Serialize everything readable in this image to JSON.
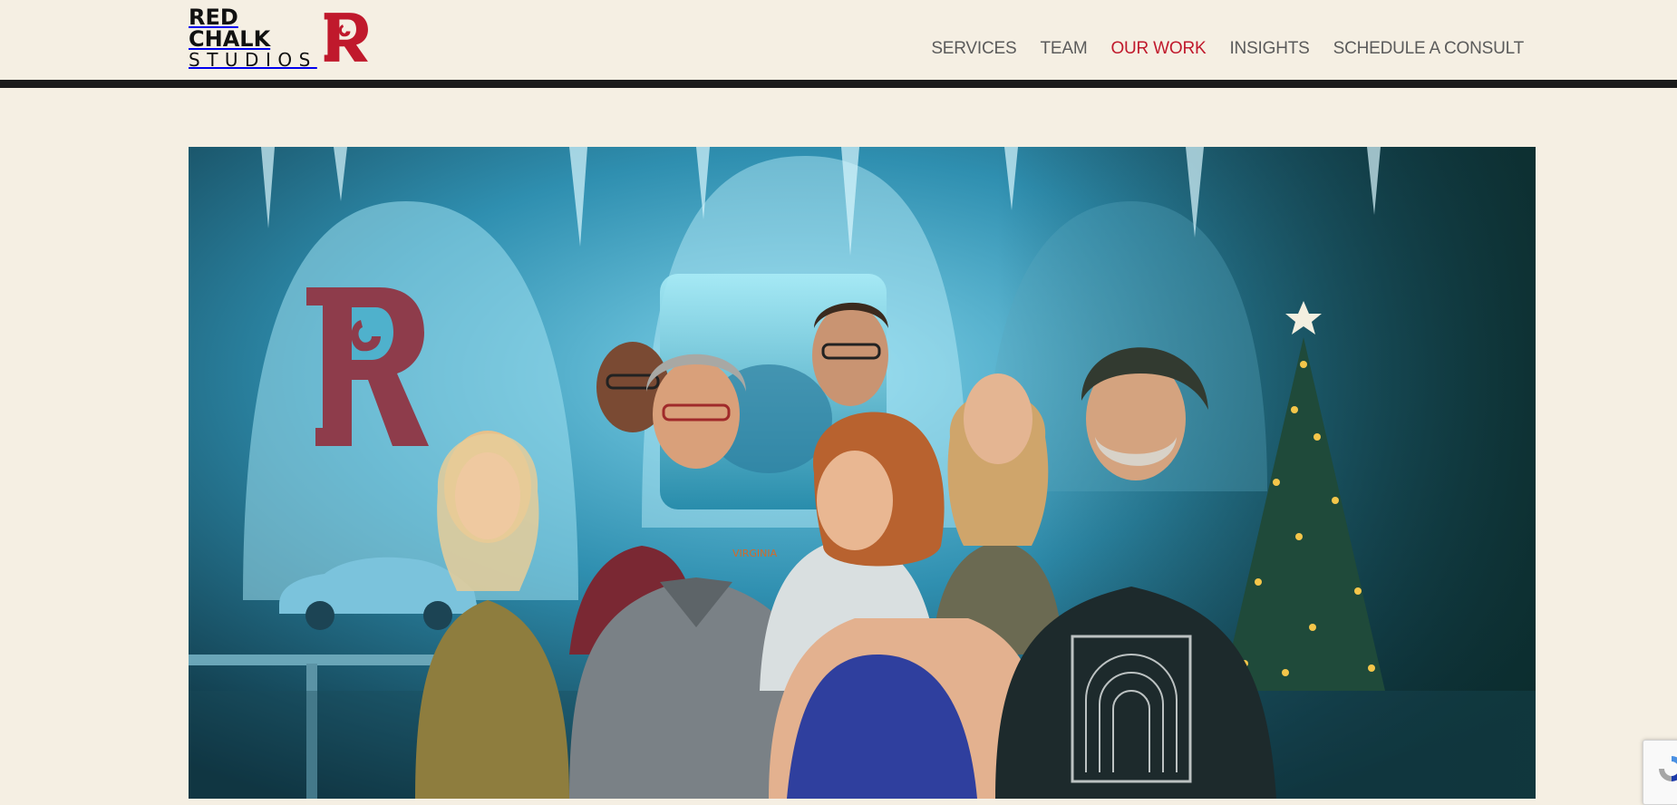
{
  "logo": {
    "line1": "RED CHALK",
    "line2": "STUDIOS",
    "mark_color": "#c0192c"
  },
  "nav": {
    "items": [
      {
        "label": "SERVICES",
        "active": false
      },
      {
        "label": "TEAM",
        "active": false
      },
      {
        "label": "OUR WORK",
        "active": true
      },
      {
        "label": "INSIGHTS",
        "active": false
      },
      {
        "label": "SCHEDULE A CONSULT",
        "active": false
      }
    ],
    "link_color": "#5b5b5b",
    "active_color": "#c0192c"
  },
  "hero": {
    "image_subject": "illustrated team photo in an ice cave",
    "shirt_text": "VIRGINIA"
  },
  "colors": {
    "background": "#f5efe3",
    "header_bar": "#1b1b1b"
  },
  "widgets": {
    "recaptcha_icon": "recaptcha-icon"
  }
}
